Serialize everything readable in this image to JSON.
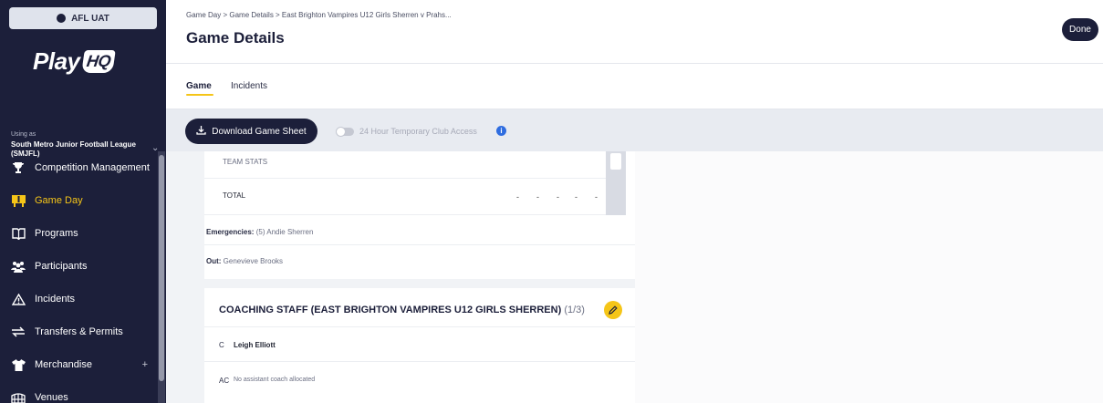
{
  "sidebar": {
    "env_label": "AFL UAT",
    "logo_text": "Play",
    "logo_badge": "HQ",
    "using_label": "Using as",
    "org_name": "South Metro Junior Football League (SMJFL)",
    "items": [
      {
        "label": "Competition Management",
        "icon": "trophy-icon"
      },
      {
        "label": "Game Day",
        "icon": "scoreboard-icon",
        "active": true
      },
      {
        "label": "Programs",
        "icon": "book-icon"
      },
      {
        "label": "Participants",
        "icon": "users-icon"
      },
      {
        "label": "Incidents",
        "icon": "warning-icon"
      },
      {
        "label": "Transfers & Permits",
        "icon": "transfer-icon"
      },
      {
        "label": "Merchandise",
        "icon": "shirt-icon",
        "expandable": "+"
      },
      {
        "label": "Venues",
        "icon": "stadium-icon"
      }
    ]
  },
  "header": {
    "breadcrumb": "Game Day  >  Game Details  >  East Brighton Vampires U12 Girls Sherren v Prahs...",
    "title": "Game Details",
    "done_label": "Done"
  },
  "tabs": [
    {
      "label": "Game",
      "active": true
    },
    {
      "label": "Incidents",
      "active": false
    }
  ],
  "toolbar": {
    "download_label": "Download Game Sheet",
    "toggle_label": "24 Hour Temporary Club Access",
    "toggle_on": false
  },
  "stats": {
    "team_stats_label": "TEAM STATS",
    "total_label": "TOTAL",
    "total_values": [
      "-",
      "-",
      "-",
      "-",
      "-"
    ]
  },
  "emergencies": {
    "label": "Emergencies:",
    "value": "(5) Andie Sherren"
  },
  "out": {
    "label": "Out:",
    "value": "Genevieve Brooks"
  },
  "coaching": {
    "title": "COACHING STAFF (EAST BRIGHTON VAMPIRES U12 GIRLS SHERREN)",
    "count": "(1/3)",
    "coach_role": "C",
    "coach_name": "Leigh Elliott",
    "assistant_role": "AC",
    "assistant_value": "No assistant coach allocated"
  },
  "colors": {
    "sidebar_bg": "#1c1f3a",
    "accent": "#f5c518",
    "info": "#2f6de0"
  }
}
